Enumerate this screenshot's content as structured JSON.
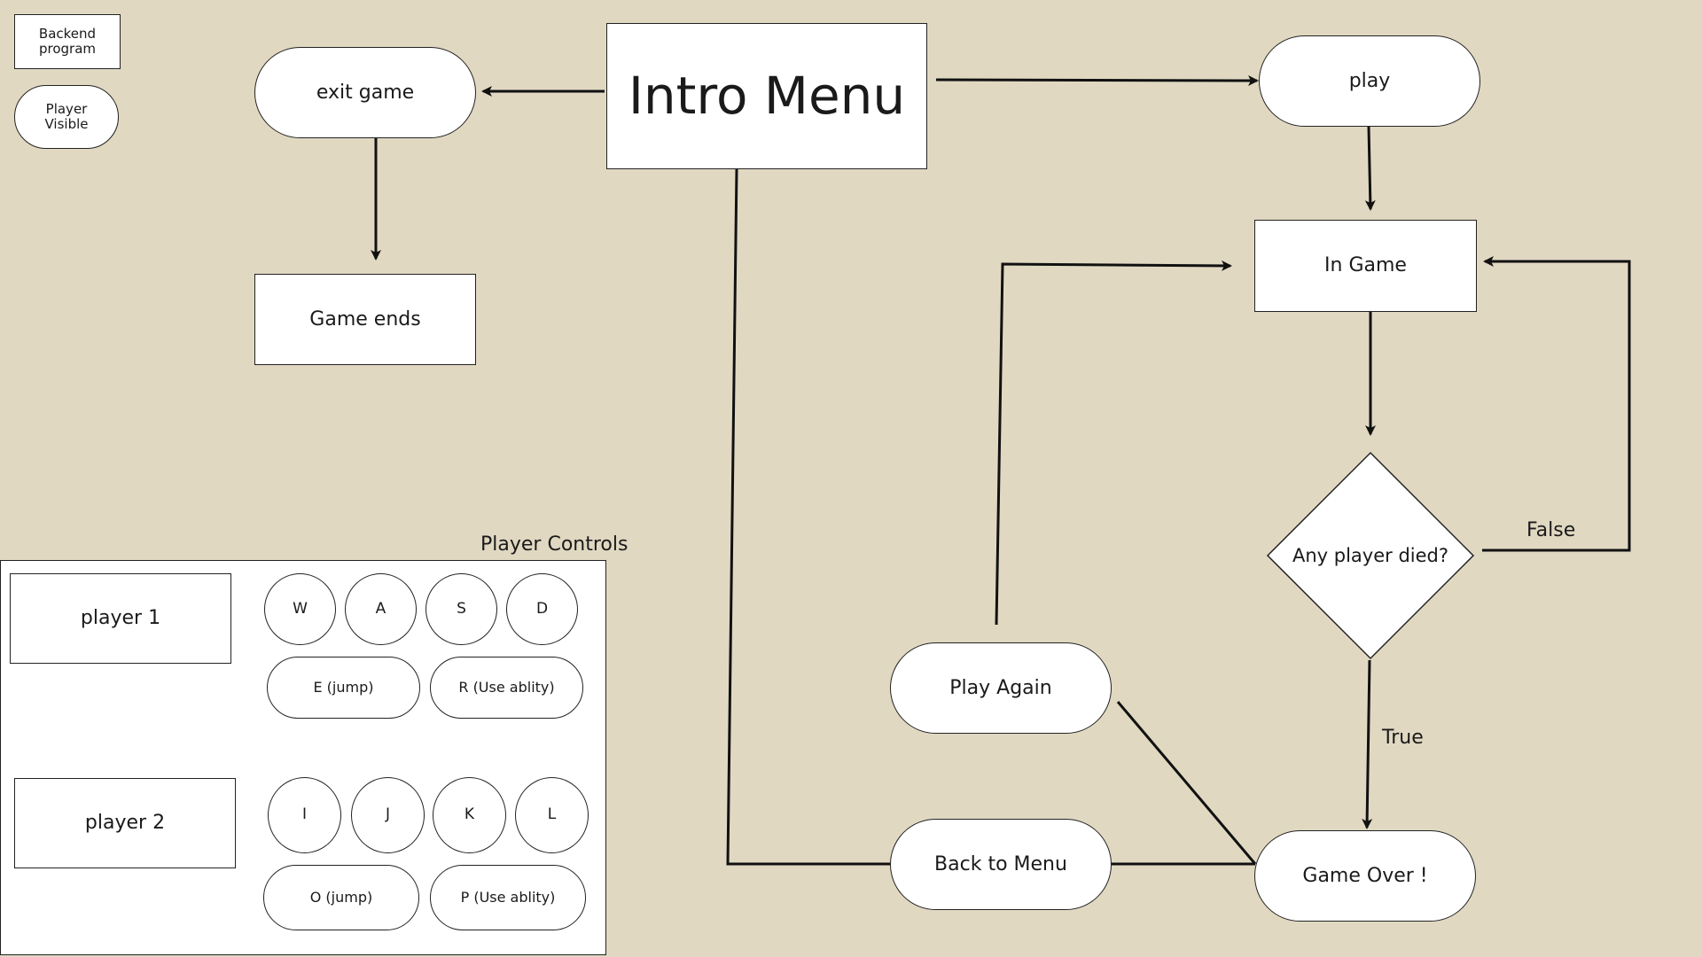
{
  "legend": {
    "backend_label": "Backend program",
    "player_visible_label": "Player Visible"
  },
  "flow": {
    "intro_menu": "Intro Menu",
    "exit_game": "exit game",
    "game_ends": "Game ends",
    "play": "play",
    "in_game": "In Game",
    "decision": "Any player died?",
    "false_label": "False",
    "true_label": "True",
    "game_over": "Game Over !",
    "play_again": "Play Again",
    "back_to_menu": "Back to Menu"
  },
  "controls": {
    "title": "Player Controls",
    "player1": {
      "label": "player 1",
      "keys": [
        "W",
        "A",
        "S",
        "D"
      ],
      "jump": "E (jump)",
      "ability": "R (Use ablity)"
    },
    "player2": {
      "label": "player 2",
      "keys": [
        "I",
        "J",
        "K",
        "L"
      ],
      "jump": "O (jump)",
      "ability": "P (Use ablity)"
    }
  }
}
